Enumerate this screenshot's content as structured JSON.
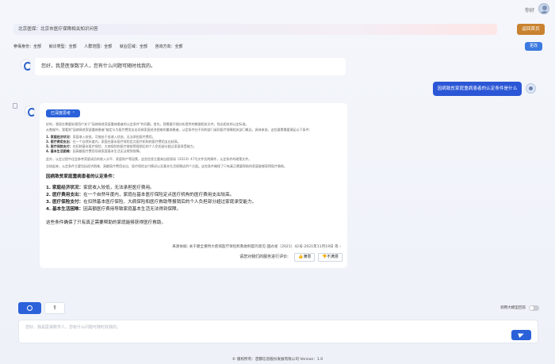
{
  "topbar": {
    "greeting": "你好"
  },
  "header": {
    "title": "北京医保：北京市医疗保障相关知识问答",
    "home_button": "返回首页"
  },
  "filters": {
    "items": [
      {
        "label": "参保身份：",
        "value": "全部"
      },
      {
        "label": "就诊类型：",
        "value": "全部"
      },
      {
        "label": "人群范围：",
        "value": "全部"
      },
      {
        "label": "就业区域：",
        "value": "全部"
      },
      {
        "label": "咨询方向：",
        "value": "全部"
      }
    ],
    "change_button": "更改"
  },
  "chat": {
    "greeting": "您好，我是医保数字人，您有什么问题可随时找我的。",
    "user_question": "因病致贫家庭重病患者的认定条件是什么",
    "answer": {
      "deep_think_button": "已深度思考 ⌃",
      "para1": "好的，我现在需要处理用户关于\"因病致贫家庭重病患者的认定条件\"的问题。首先，我需要仔细分析提供的数据相关文件，找出相关的认定标准。",
      "para2": "从数据中，我看到\"因病致贫家庭重病患者\"被定义为医疗费用支出导致家庭经济困难的重病患者，认定条件在不同的部门或同医疗保障相关部门概念，具体来说，这些要素需要满足以下条件：",
      "list": [
        {
          "head": "1. 家庭经济状况：",
          "text": "家庭收入较低，可能处于低收入状态，无法承担医疗费用。"
        },
        {
          "head": "2. 医疗费用支出：",
          "text": "在一个自然年度内，家庭在基本医疗保险定点医疗机构的医疗费用支出较高。"
        },
        {
          "head": "3. 医疗保险支付：",
          "text": "在扣除基本医疗保险、大病保险和医疗救助等报销后的个人负担部分超过家庭承受能力。"
        },
        {
          "head": "4. 基本生活困难：",
          "text": "因高额医疗费用导致家庭基本生活无法得到保障。"
        }
      ],
      "para3": "此外，认定过程中还会参考家庭成员的收入水平、家庭财产等因素，这些信息主要来自医保局《2023》47号文件及附属件，认定条件的政策文件。",
      "para4": "总结起来，认定条件主要包括经济困难、高额医疗费用支出、医疗保险支付情况以及基本生活保障这四个方面。这些条件确保了只有真正需要帮助的家庭能够获得医疗救助。",
      "section_title": "因病致贫家庭重病患者的认定条件：",
      "big_list": [
        {
          "head": "1. 家庭经济状况：",
          "text": "家庭收入较低，无法承担医疗费用。"
        },
        {
          "head": "2. 医疗费用支出：",
          "text": "在一个自然年度内，家庭在基本医疗保险定点医疗机构的医疗费用支出较高。"
        },
        {
          "head": "3. 医疗保险支付：",
          "text": "在扣除基本医疗保险、大病保险和医疗救助等报销后的个人负担部分超过家庭承受能力。"
        },
        {
          "head": "4. 基本生活困难：",
          "text": "因高额医疗费用导致家庭基本生活无法得到保障。"
        }
      ],
      "summary": "这些条件确保了只有真正需要帮助的家庭能够获得医疗救助。",
      "source": "来源依据: 关于健全重特大疾病医疗保险和救助制度的意见-国办发〔2021〕42号-2021年11月19日 等 ›",
      "feedback_question": "请您对我们的服务进行评价:",
      "satisfied_label": "满意",
      "unsatisfied_label": "不满意"
    }
  },
  "composer": {
    "share_icon_glyph": "⇪",
    "model_toggle_label": "调用大模型回答",
    "placeholder": "您好，我是医保数字人，您有什么问题可随时找我的。"
  },
  "footer": {
    "text": "© 版权所有：首都信息股份发展有限公司 Version：1.0"
  }
}
